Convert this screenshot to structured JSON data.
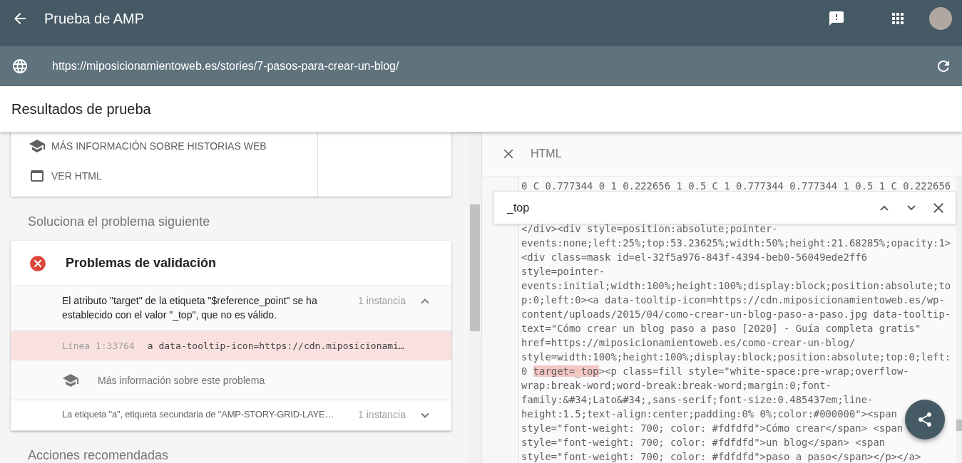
{
  "app_bar": {
    "title": "Prueba de AMP"
  },
  "url_bar": {
    "url": "https://miposicionamientoweb.es/stories/7-pasos-para-crear-un-blog/"
  },
  "results_header": {
    "title": "Resultados de prueba"
  },
  "info_card": {
    "links": [
      {
        "label": "MÁS INFORMACIÓN SOBRE HISTORIAS WEB",
        "kind": "learn"
      },
      {
        "label": "VER HTML",
        "kind": "html"
      }
    ]
  },
  "fix_heading": "Soluciona el problema siguiente",
  "validation_card": {
    "title": "Problemas de validación",
    "issues": [
      {
        "message": "El atributo \"target\" de la etiqueta \"$reference_point\" se ha establecido con el valor \"_top\", que no es válido.",
        "count": "1 instancia",
        "expanded": true,
        "line_ref": "Línea 1:33764",
        "snippet": "a data-tooltip-icon=https://cdn.miposicionami…",
        "learn_more": "Más información sobre este problema"
      },
      {
        "message": "La etiqueta \"a\", etiqueta secundaria de \"AMP-STORY-GRID-LAYE…",
        "count": "1 instancia",
        "expanded": false
      }
    ]
  },
  "recommended_heading": "Acciones recomendadas",
  "html_panel": {
    "title": "HTML",
    "search": {
      "value": "_top"
    },
    "lines": [
      {
        "text": "0 C 0.777344 0 1 0.222656 1 0.5 C 1 0.777344 0.777344 1 0.5 1 C 0.222656"
      },
      {
        "text": "</div><div style=position:absolute;pointer-"
      },
      {
        "text": "events:none;left:25%;top:53.23625%;width:50%;height:21.68285%;opacity:1>"
      },
      {
        "text": "<div class=mask id=el-32f5a976-843f-4394-beb0-56049ede2ff6"
      },
      {
        "text": "style=pointer-"
      },
      {
        "text": "events:initial;width:100%;height:100%;display:block;position:absolute;to"
      },
      {
        "text": "p:0;left:0><a data-tooltip-icon=https://cdn.miposicionamientoweb.es/wp-"
      },
      {
        "text": "content/uploads/2015/04/como-crear-un-blog-paso-a-paso.jpg data-tooltip-"
      },
      {
        "text": "text=\"Cómo crear un blog paso a paso [2020] - Guía completa gratis\""
      },
      {
        "text": "href=https://miposicionamientoweb.es/como-crear-un-blog/"
      },
      {
        "text": "style=width:100%;height:100%;display:block;position:absolute;top:0;left:"
      },
      {
        "text": "0 ",
        "match": "target=_top",
        "rest": "><p class=fill style=\"white-space:pre-wrap;overflow-"
      },
      {
        "text": "wrap:break-word;word-break:break-word;margin:0;font-"
      },
      {
        "text": "family:&#34;Lato&#34;,sans-serif;font-size:0.485437em;line-"
      },
      {
        "text": "height:1.5;text-align:center;padding:0% 0%;color:#000000\"><span"
      },
      {
        "text": "style=\"font-weight: 700; color: #fdfdfd\">Cómo crear</span> <span"
      },
      {
        "text": "style=\"font-weight: 700; color: #fdfdfd\">un blog</span> <span"
      },
      {
        "text": "style=\"font-weight: 700; color: #fdfdfd\">paso a paso</span></p></a>"
      }
    ]
  }
}
